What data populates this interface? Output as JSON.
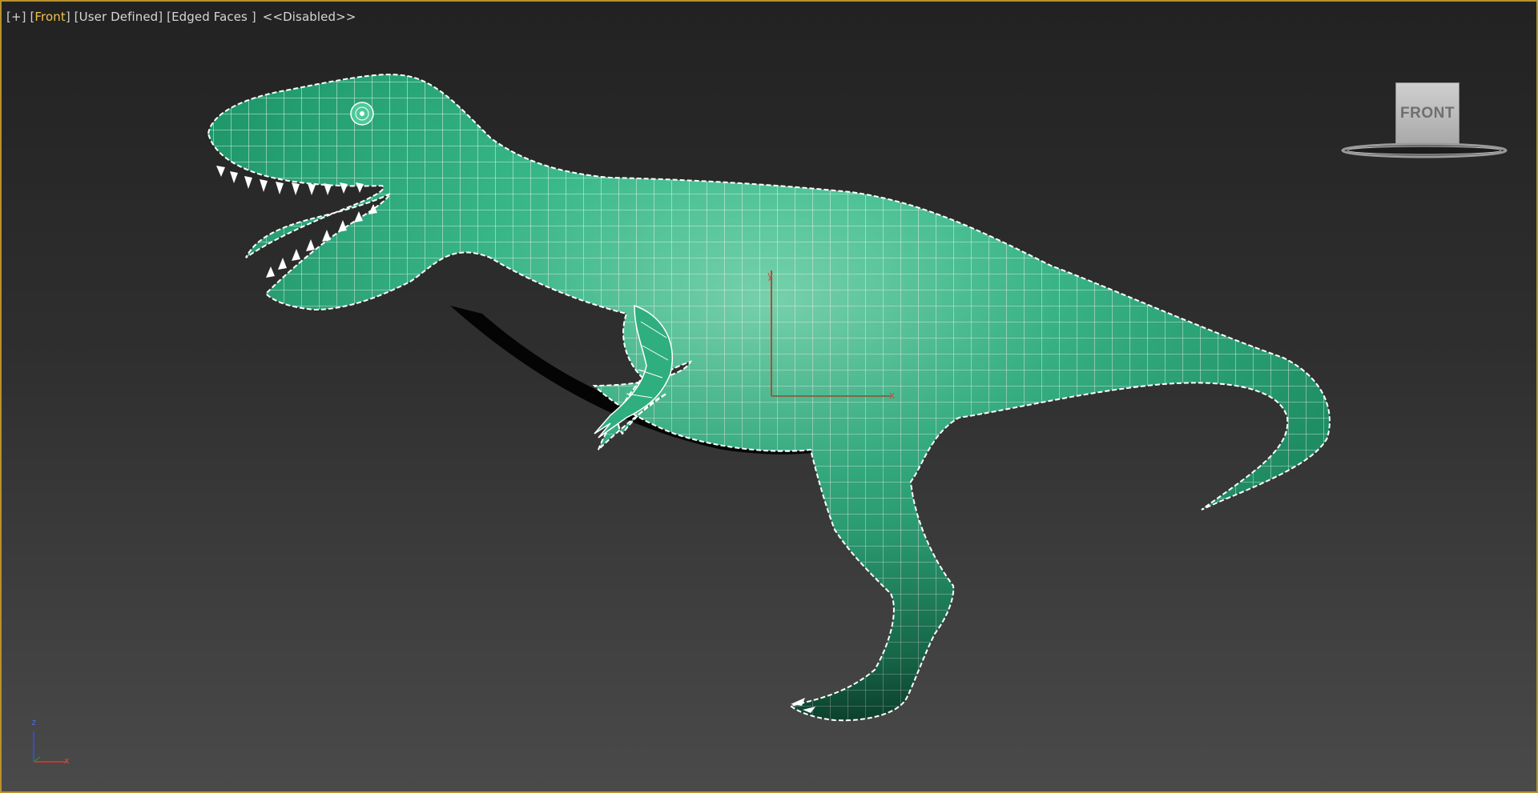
{
  "viewport": {
    "labels": {
      "plus": "+",
      "view": "Front",
      "camera": "User Defined",
      "shading": "Edged Faces",
      "status": "<<Disabled>>"
    },
    "viewcube": {
      "face_label": "FRONT"
    },
    "gizmo": {
      "x_label": "x",
      "y_label": "y"
    },
    "axis_tripod": {
      "z_label": "z",
      "x_label": "x"
    }
  },
  "colors": {
    "active_border": "#b8902e",
    "active_label": "#f2c14e",
    "mesh_fill": "#34b888",
    "wire": "#ffffff",
    "x_axis": "#c0392b",
    "y_axis": "#2e7d32",
    "z_axis": "#3050c8"
  }
}
